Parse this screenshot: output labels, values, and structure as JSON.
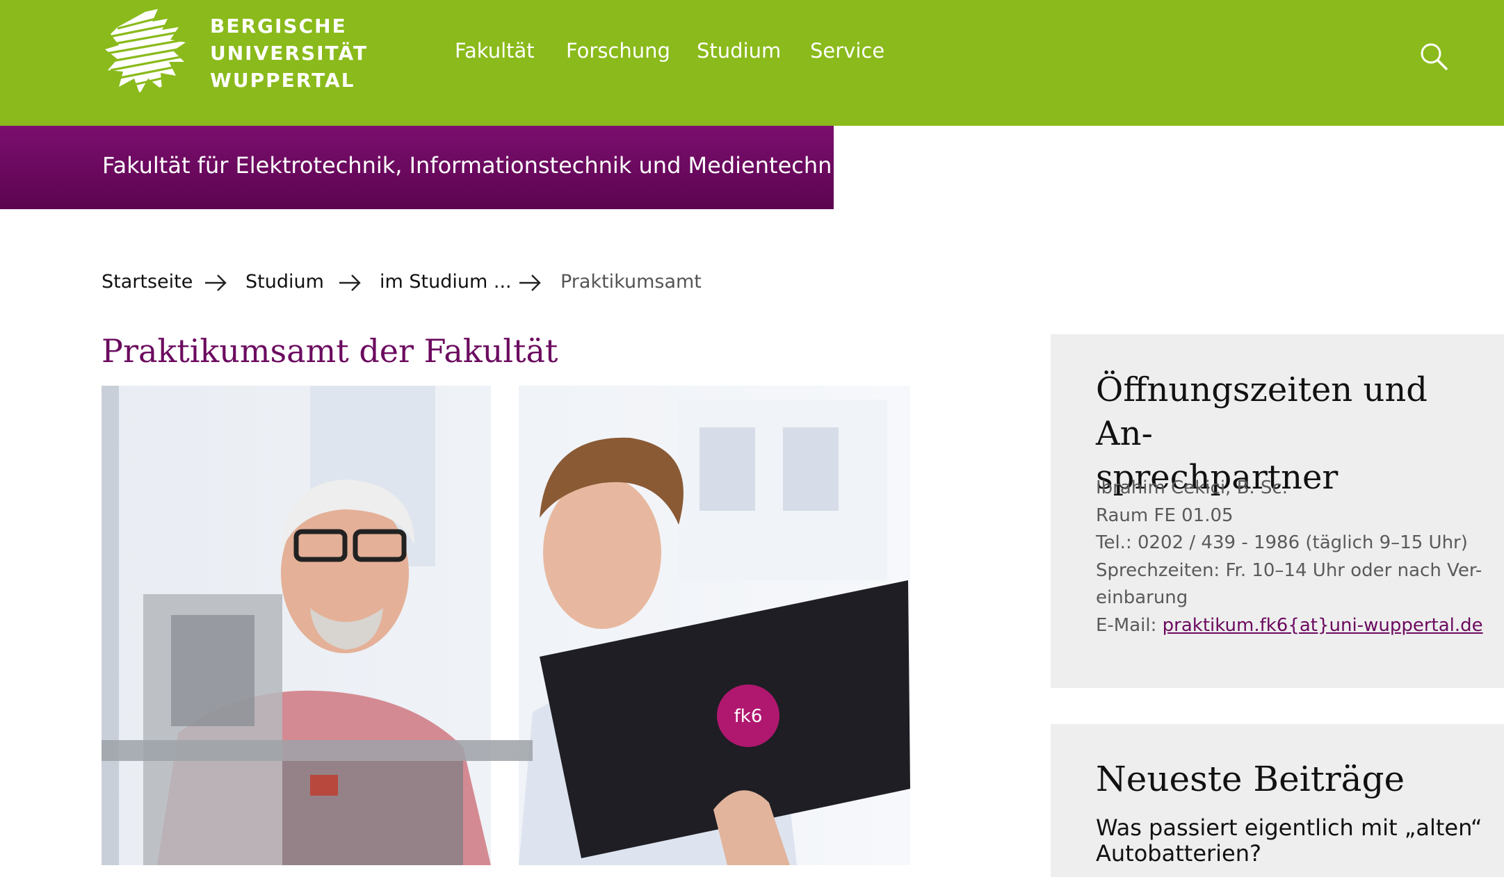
{
  "header": {
    "logo_lines": [
      "BERGISCHE",
      "UNIVERSITÄT",
      "WUPPERTAL"
    ],
    "nav": [
      "Fakultät",
      "Forschung",
      "Studium",
      "Service"
    ],
    "search_icon": "search-icon"
  },
  "faculty": {
    "title": "Fakultät für Elektrotechnik, Informationstechnik und Medientechnik"
  },
  "breadcrumb": {
    "items": [
      "Startseite",
      "Studium",
      "im Studium ...",
      "Praktikumsamt"
    ],
    "separator_icon": "arrow-right-icon"
  },
  "main": {
    "title": "Praktikumsamt der Fakultät",
    "hero_image": {
      "badge_text": "fk6"
    }
  },
  "sidebar": {
    "contact": {
      "heading_lines": [
        "Öffnungszeiten und An-",
        "sprechpartner"
      ],
      "lines": [
        "Ibrahim Cekici, B. Sc.",
        "Raum FE 01.05",
        "Tel.:  0202 / 439 - 1986 (täglich 9–15 Uhr)",
        "Sprechzeiten: Fr. 10–14 Uhr oder nach Ver-",
        "einbarung"
      ],
      "email_label": "E-Mail: ",
      "email_link": "praktikum.fk6{at}uni-wuppertal.de"
    },
    "news": {
      "heading": "Neueste Beiträge",
      "item_title": "Was passiert eigentlich mit „alten“ Autobatterien?"
    }
  },
  "colors": {
    "brand_green": "#8aba1b",
    "faculty_purple": "#6b0a5f",
    "sidebar_bg": "#eeeeee"
  }
}
